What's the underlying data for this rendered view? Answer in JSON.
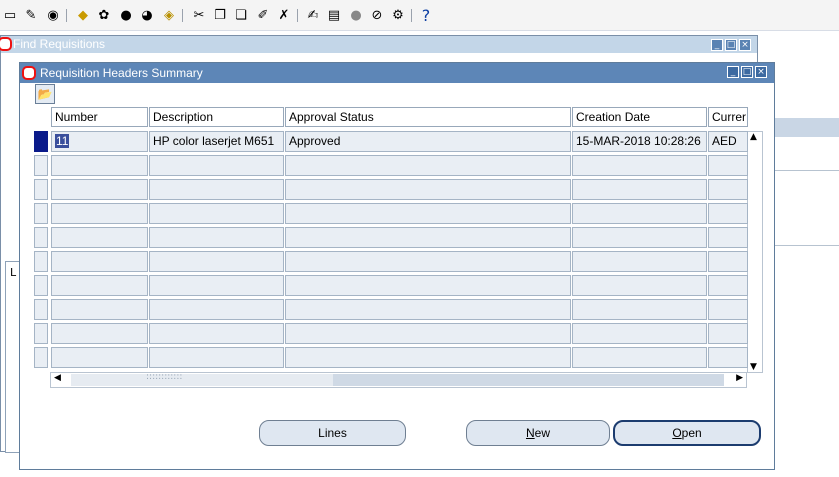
{
  "toolbar": {
    "icons": [
      "save-icon",
      "navigate-icon",
      "zoom-icon",
      "find-icon",
      "print-icon",
      "switch-icon",
      "cut-icon",
      "copy-icon",
      "paste-icon",
      "clear-icon",
      "edit-icon",
      "folder-icon",
      "translation-icon",
      "attachment-icon",
      "tools-icon",
      "help-icon"
    ],
    "help_label": "?"
  },
  "background_window": {
    "title": "Find Requisitions",
    "left_tab_letter": "L"
  },
  "dialog": {
    "title": "Requisition Headers Summary",
    "columns": [
      "Number",
      "Description",
      "Approval Status",
      "Creation Date",
      "Currer"
    ],
    "rows": [
      [
        "11",
        "HP color laserjet M651",
        "Approved",
        "15-MAR-2018 10:28:26",
        "AED"
      ],
      [
        "",
        "",
        "",
        "",
        ""
      ],
      [
        "",
        "",
        "",
        "",
        ""
      ],
      [
        "",
        "",
        "",
        "",
        ""
      ],
      [
        "",
        "",
        "",
        "",
        ""
      ],
      [
        "",
        "",
        "",
        "",
        ""
      ],
      [
        "",
        "",
        "",
        "",
        ""
      ],
      [
        "",
        "",
        "",
        "",
        ""
      ],
      [
        "",
        "",
        "",
        "",
        ""
      ],
      [
        "",
        "",
        "",
        "",
        ""
      ]
    ],
    "hscroll_dots": "::::::::::::"
  },
  "buttons": {
    "lines": "Lines",
    "new_u": "N",
    "new_rest": "ew",
    "open_u": "O",
    "open_rest": "pen"
  },
  "colors": {
    "title_active": "#5d86b7",
    "title_inactive": "#c3d6e8",
    "selected_row": "#0a1a8a"
  }
}
